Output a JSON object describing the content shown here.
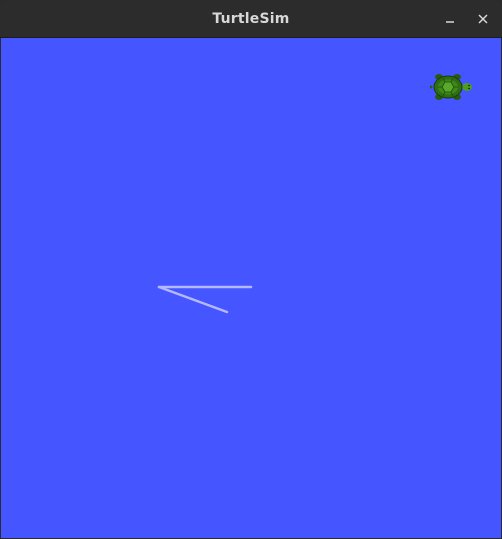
{
  "window": {
    "title": "TurtleSim",
    "controls": [
      "minimize-icon",
      "close-icon"
    ]
  },
  "canvas": {
    "background": "#4555ff",
    "pen_color": "#b3b8ff"
  },
  "turtle": {
    "icon": "turtle-icon",
    "shell_color": "#3d8a1a",
    "heading": "right"
  }
}
